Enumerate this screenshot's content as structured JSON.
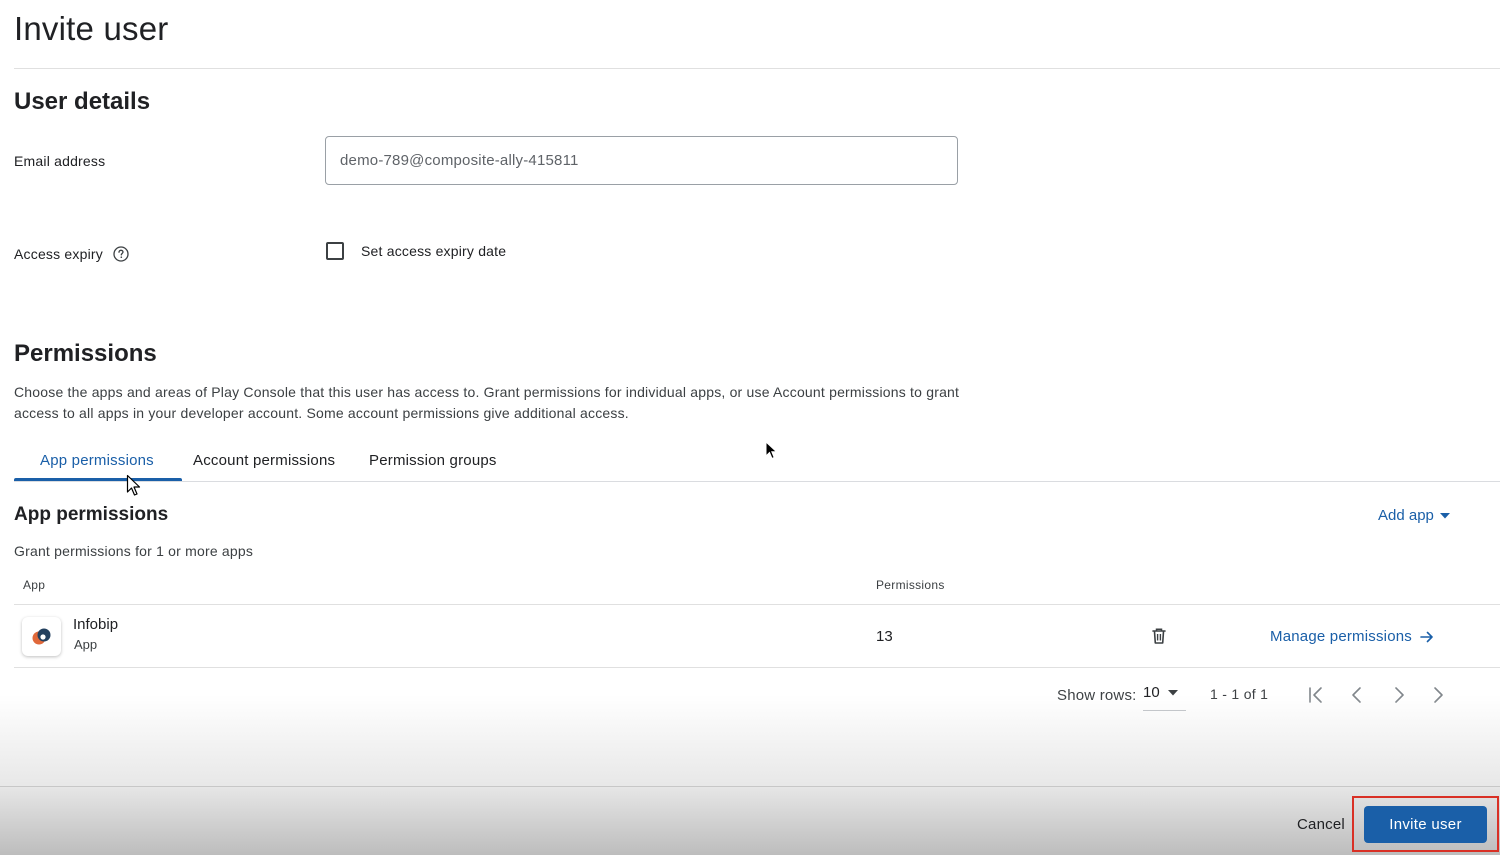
{
  "page": {
    "title": "Invite user"
  },
  "user_details": {
    "title": "User details",
    "email_label": "Email address",
    "email_value": "demo-789@composite-ally-415811",
    "access_expiry_label": "Access expiry",
    "access_expiry_checkbox_label": "Set access expiry date",
    "access_expiry_checked": false
  },
  "permissions": {
    "title": "Permissions",
    "description": "Choose the apps and areas of Play Console that this user has access to. Grant permissions for individual apps, or use Account permissions to grant access to all apps in your developer account. Some account permissions give additional access.",
    "tabs": [
      {
        "label": "App permissions",
        "active": true
      },
      {
        "label": "Account permissions",
        "active": false
      },
      {
        "label": "Permission groups",
        "active": false
      }
    ]
  },
  "app_permissions": {
    "title": "App permissions",
    "add_app_label": "Add app",
    "hint": "Grant permissions for 1 or more apps",
    "columns": {
      "app": "App",
      "permissions": "Permissions"
    },
    "rows": [
      {
        "name": "Infobip",
        "type": "App",
        "permissions": "13",
        "manage_label": "Manage permissions"
      }
    ],
    "pagination": {
      "show_rows_label": "Show rows:",
      "rows_per_page": "10",
      "range": "1 - 1 of 1"
    }
  },
  "footer": {
    "cancel_label": "Cancel",
    "invite_label": "Invite user"
  },
  "colors": {
    "accent": "#1a5fa8",
    "highlight": "#d93025",
    "app_icon_orange": "#e0683a",
    "app_icon_navy": "#23405e"
  }
}
